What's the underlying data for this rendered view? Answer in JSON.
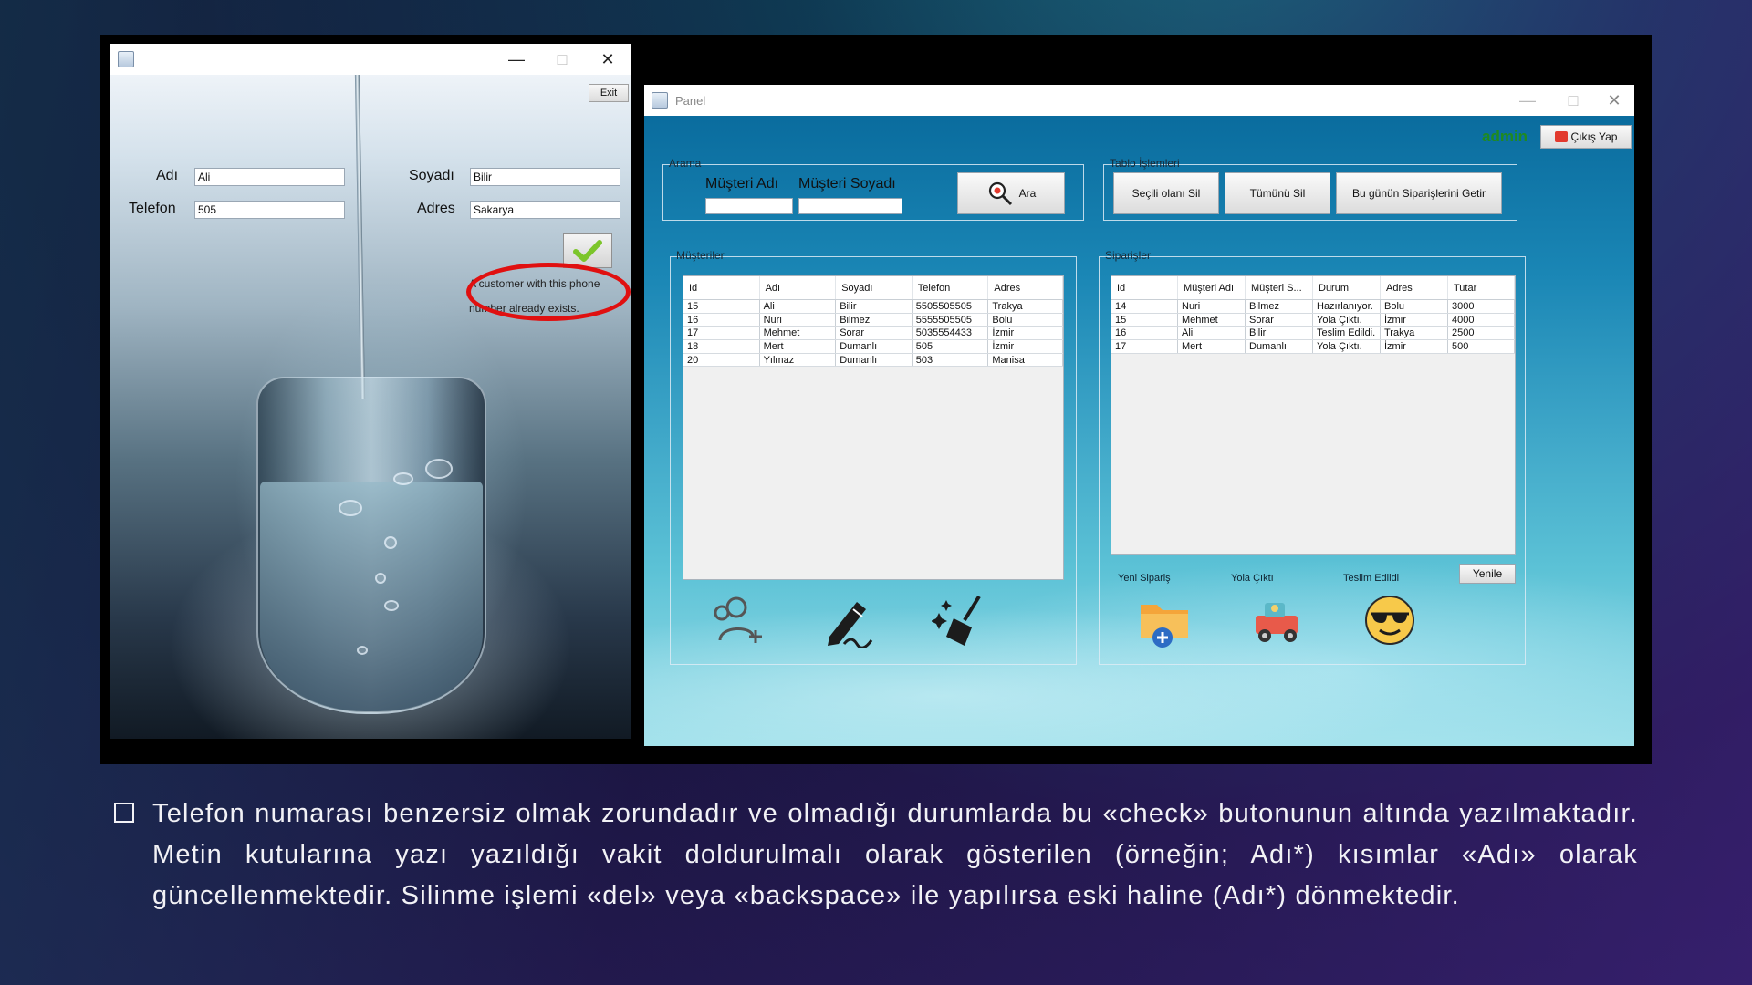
{
  "left_window": {
    "title": "",
    "exit_label": "Exit",
    "labels": {
      "adi": "Adı",
      "telefon": "Telefon",
      "soyadi": "Soyadı",
      "adres": "Adres"
    },
    "values": {
      "adi": "Ali",
      "telefon": "505",
      "soyadi": "Bilir",
      "adres": "Sakarya"
    },
    "error_message": "A customer with this phone number already exists."
  },
  "panel": {
    "title": "Panel",
    "username": "admin",
    "logout_label": "Çıkış Yap",
    "search_group": {
      "title": "Arama",
      "customer_name_label": "Müşteri Adı",
      "customer_surname_label": "Müşteri Soyadı",
      "search_button": "Ara"
    },
    "table_ops_group": {
      "title": "Tablo İşlemleri",
      "delete_selected": "Seçili olanı Sil",
      "delete_all": "Tümünü Sil",
      "today_orders": "Bu günün Siparişlerini Getir"
    },
    "customers": {
      "title": "Müşteriler",
      "columns": [
        "Id",
        "Adı",
        "Soyadı",
        "Telefon",
        "Adres"
      ],
      "rows": [
        [
          "15",
          "Ali",
          "Bilir",
          "5505505505",
          "Trakya"
        ],
        [
          "16",
          "Nuri",
          "Bilmez",
          "5555505505",
          "Bolu"
        ],
        [
          "17",
          "Mehmet",
          "Sorar",
          "5035554433",
          "İzmir"
        ],
        [
          "18",
          "Mert",
          "Dumanlı",
          "505",
          "İzmir"
        ],
        [
          "20",
          "Yılmaz",
          "Dumanlı",
          "503",
          "Manisa"
        ]
      ]
    },
    "orders": {
      "title": "Siparişler",
      "columns": [
        "Id",
        "Müşteri Adı",
        "Müşteri S...",
        "Durum",
        "Adres",
        "Tutar"
      ],
      "rows": [
        [
          "14",
          "Nuri",
          "Bilmez",
          "Hazırlanıyor.",
          "Bolu",
          "3000"
        ],
        [
          "15",
          "Mehmet",
          "Sorar",
          "Yola Çıktı.",
          "İzmir",
          "4000"
        ],
        [
          "16",
          "Ali",
          "Bilir",
          "Teslim Edildi.",
          "Trakya",
          "2500"
        ],
        [
          "17",
          "Mert",
          "Dumanlı",
          "Yola Çıktı.",
          "İzmir",
          "500"
        ]
      ],
      "refresh_label": "Yenile",
      "action_labels": {
        "new_order": "Yeni Sipariş",
        "on_the_way": "Yola Çıktı",
        "delivered": "Teslim Edildi"
      }
    }
  },
  "caption": "Telefon numarası benzersiz olmak zorundadır ve olmadığı durumlarda bu «check» butonunun altında yazılmaktadır. Metin kutularına yazı yazıldığı vakit doldurulmalı olarak gösterilen (örneğin; Adı*) kısımlar «Adı» olarak güncellenmektedir. Silinme işlemi «del» veya «backspace» ile yapılırsa eski haline (Adı*) dönmektedir.",
  "colors": {
    "error_ring": "#e01010",
    "admin_text": "#1f8a1f",
    "check_green": "#7cc52a"
  },
  "icons": [
    "app-icon",
    "minimize-icon",
    "maximize-icon",
    "close-icon",
    "check-icon",
    "search-icon",
    "logout-icon",
    "add-user-icon",
    "pen-icon",
    "broom-icon",
    "new-order-folder-icon",
    "truck-icon",
    "sunglasses-smiley-icon"
  ]
}
